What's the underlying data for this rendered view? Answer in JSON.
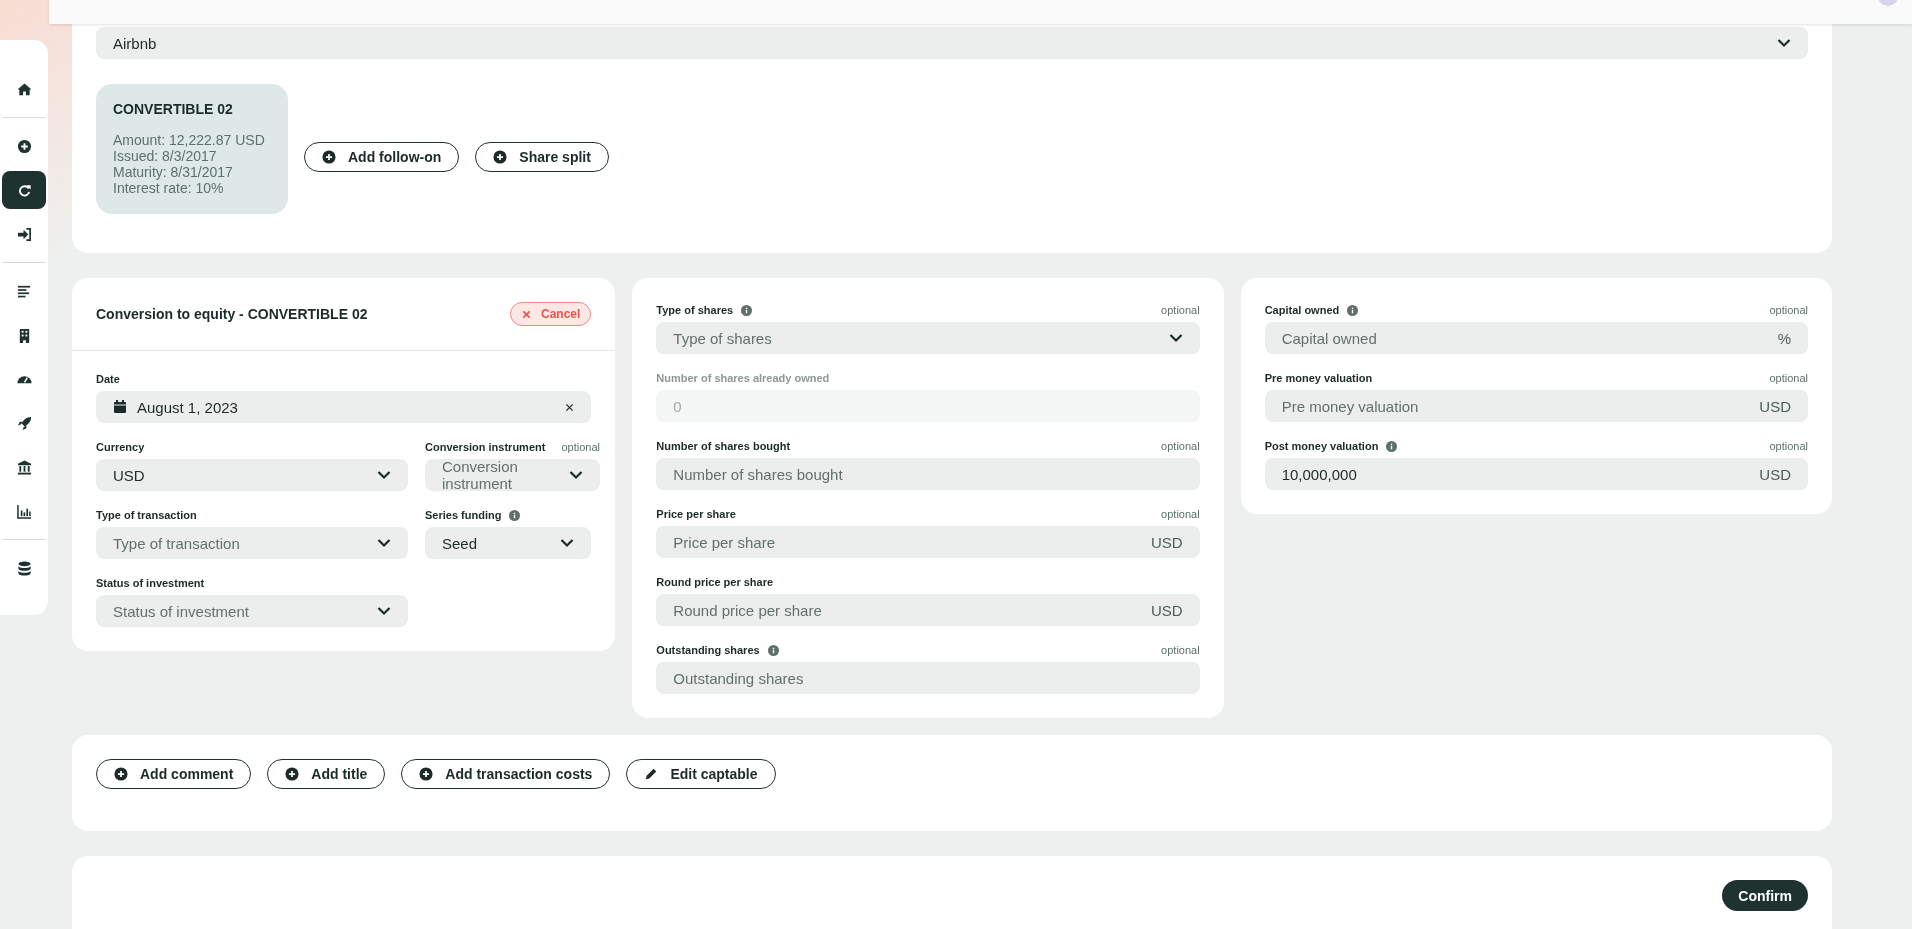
{
  "sidebar": {
    "items": [
      {
        "selected": false
      },
      {
        "selected": false
      },
      {
        "selected": true
      },
      {
        "selected": false
      },
      {
        "selected": false
      },
      {
        "selected": false
      },
      {
        "selected": false
      },
      {
        "selected": false
      },
      {
        "selected": false
      },
      {
        "selected": false
      },
      {
        "selected": false
      }
    ]
  },
  "company_select": {
    "value": "Airbnb"
  },
  "instrument_card": {
    "title": "CONVERTIBLE 02",
    "lines": [
      "Amount: 12,222.87 USD",
      "Issued: 8/3/2017",
      "Maturity: 8/31/2017",
      "Interest rate: 10%"
    ]
  },
  "instrument_actions": [
    "Add follow-on",
    "Share split"
  ],
  "conversion": {
    "title": "Conversion to equity - CONVERTIBLE 02",
    "cancel": "Cancel",
    "rows": [
      [
        {
          "kind": "date",
          "label": "Date",
          "value": "August 1, 2023"
        }
      ],
      [
        {
          "kind": "select",
          "label": "Currency",
          "value": "USD"
        },
        {
          "kind": "select",
          "label": "Conversion instrument",
          "optional": "optional",
          "placeholder": "Conversion instrument"
        }
      ],
      [
        {
          "kind": "select",
          "label": "Type of transaction",
          "placeholder": "Type of transaction"
        },
        {
          "kind": "select",
          "label": "Series funding",
          "value": "Seed",
          "info": true
        }
      ],
      [
        {
          "kind": "select",
          "label": "Status of investment",
          "placeholder": "Status of investment"
        }
      ]
    ]
  },
  "shares_panel": {
    "fields": [
      {
        "kind": "select",
        "label": "Type of shares",
        "optional": "optional",
        "placeholder": "Type of shares",
        "info": true
      },
      {
        "kind": "text",
        "label": "Number of shares already owned",
        "placeholder": "0",
        "disabled": true
      },
      {
        "kind": "text",
        "label": "Number of shares bought",
        "optional": "optional",
        "placeholder": "Number of shares bought"
      },
      {
        "kind": "text",
        "label": "Price per share",
        "optional": "optional",
        "placeholder": "Price per share",
        "unit": "USD"
      },
      {
        "kind": "text",
        "label": "Round price per share",
        "placeholder": "Round price per share",
        "unit": "USD"
      },
      {
        "kind": "text",
        "label": "Outstanding shares",
        "optional": "optional",
        "placeholder": "Outstanding shares",
        "info": true
      }
    ]
  },
  "valuation_panel": {
    "fields": [
      {
        "kind": "text",
        "label": "Capital owned",
        "optional": "optional",
        "placeholder": "Capital owned",
        "unit": "%",
        "info": true
      },
      {
        "kind": "text",
        "label": "Pre money valuation",
        "optional": "optional",
        "placeholder": "Pre money valuation",
        "unit": "USD"
      },
      {
        "kind": "text",
        "label": "Post money valuation",
        "optional": "optional",
        "value": "10,000,000",
        "unit": "USD",
        "info": true
      }
    ]
  },
  "bottom_actions": [
    {
      "kind": "add",
      "label": "Add comment"
    },
    {
      "kind": "add",
      "label": "Add title"
    },
    {
      "kind": "add",
      "label": "Add transaction costs"
    },
    {
      "kind": "edit",
      "label": "Edit captable"
    }
  ],
  "confirm": "Confirm"
}
